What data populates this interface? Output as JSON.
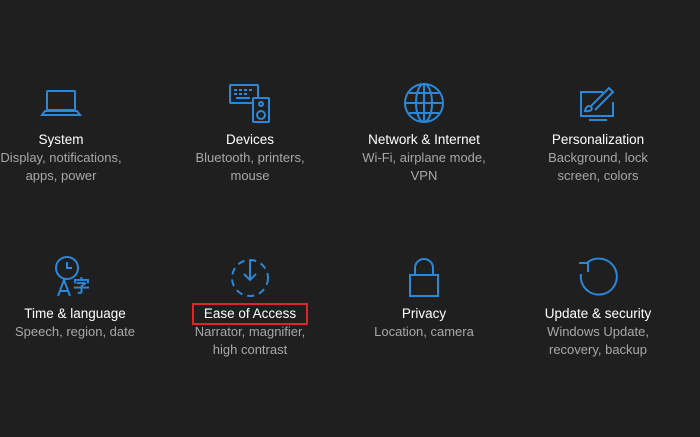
{
  "accent_color": "#2b88d8",
  "highlight_color": "#e0242a",
  "tiles": [
    {
      "title": "System",
      "desc1": "Display, notifications,",
      "desc2": "apps, power",
      "icon": "laptop-icon"
    },
    {
      "title": "Devices",
      "desc1": "Bluetooth, printers,",
      "desc2": "mouse",
      "icon": "keyboard-speaker-icon"
    },
    {
      "title": "Network & Internet",
      "desc1": "Wi-Fi, airplane mode,",
      "desc2": "VPN",
      "icon": "globe-icon"
    },
    {
      "title": "Personalization",
      "desc1": "Background, lock",
      "desc2": "screen, colors",
      "icon": "paintbrush-screen-icon"
    },
    {
      "title": "Time & language",
      "desc1": "Speech, region, date",
      "desc2": "",
      "icon": "clock-language-icon"
    },
    {
      "title": "Ease of Access",
      "desc1": "Narrator, magnifier,",
      "desc2": "high contrast",
      "icon": "ease-of-access-icon"
    },
    {
      "title": "Privacy",
      "desc1": "Location, camera",
      "desc2": "",
      "icon": "lock-icon"
    },
    {
      "title": "Update & security",
      "desc1": "Windows Update,",
      "desc2": "recovery, backup",
      "icon": "refresh-icon"
    }
  ]
}
